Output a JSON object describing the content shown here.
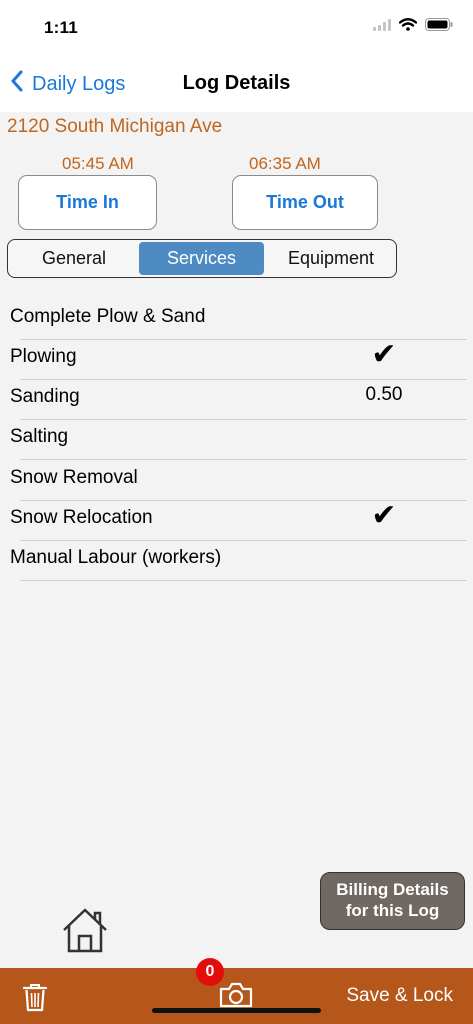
{
  "status": {
    "time": "1:11"
  },
  "nav": {
    "back_label": "Daily Logs",
    "title": "Log Details"
  },
  "address": "2120 South Michigan Ave",
  "time_in": {
    "value": "05:45 AM",
    "button": "Time In"
  },
  "time_out": {
    "value": "06:35 AM",
    "button": "Time Out"
  },
  "tabs": [
    {
      "label": "General"
    },
    {
      "label": "Services"
    },
    {
      "label": "Equipment"
    }
  ],
  "active_tab": "Services",
  "services": [
    {
      "label": "Complete Plow & Sand",
      "value": ""
    },
    {
      "label": "Plowing",
      "value": "✔"
    },
    {
      "label": "Sanding",
      "value": "0.50"
    },
    {
      "label": "Salting",
      "value": ""
    },
    {
      "label": "Snow Removal",
      "value": ""
    },
    {
      "label": "Snow Relocation",
      "value": "✔"
    },
    {
      "label": "Manual Labour (workers)",
      "value": ""
    }
  ],
  "billing": {
    "line1": "Billing Details",
    "line2": "for this Log"
  },
  "bottom": {
    "badge_count": "0",
    "save_label": "Save & Lock"
  },
  "colors": {
    "accent": "#1a78d9",
    "orange_text": "#c0661e",
    "toolbar": "#b5571b",
    "tab_active": "#4f8bc3"
  }
}
